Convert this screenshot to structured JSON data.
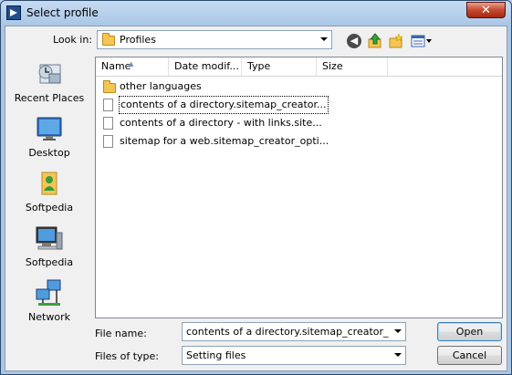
{
  "window": {
    "title": "Select profile",
    "close_label": "✕"
  },
  "toolbar": {
    "look_in_label": "Look in:",
    "look_in_value": "Profiles",
    "icons": [
      "back-icon",
      "up-folder-icon",
      "new-folder-icon",
      "views-menu-icon"
    ]
  },
  "places": [
    {
      "label": "Recent Places",
      "icon": "recent-places-icon"
    },
    {
      "label": "Desktop",
      "icon": "desktop-icon"
    },
    {
      "label": "Softpedia",
      "icon": "user-folder-icon"
    },
    {
      "label": "Softpedia",
      "icon": "computer-icon"
    },
    {
      "label": "Network",
      "icon": "network-icon"
    }
  ],
  "columns": [
    "Name",
    "Date modif...",
    "Type",
    "Size"
  ],
  "files": [
    {
      "name": "other languages",
      "kind": "folder"
    },
    {
      "name": "contents of a directory.sitemap_creator...",
      "kind": "file"
    },
    {
      "name": "contents of a directory - with links.site...",
      "kind": "file"
    },
    {
      "name": "sitemap for a web.sitemap_creator_opti...",
      "kind": "file"
    }
  ],
  "bottom": {
    "file_name_label": "File name:",
    "file_name_value": "contents of a directory.sitemap_creator_options",
    "file_type_label": "Files of type:",
    "file_type_value": "Setting files",
    "open_label": "Open",
    "cancel_label": "Cancel"
  }
}
